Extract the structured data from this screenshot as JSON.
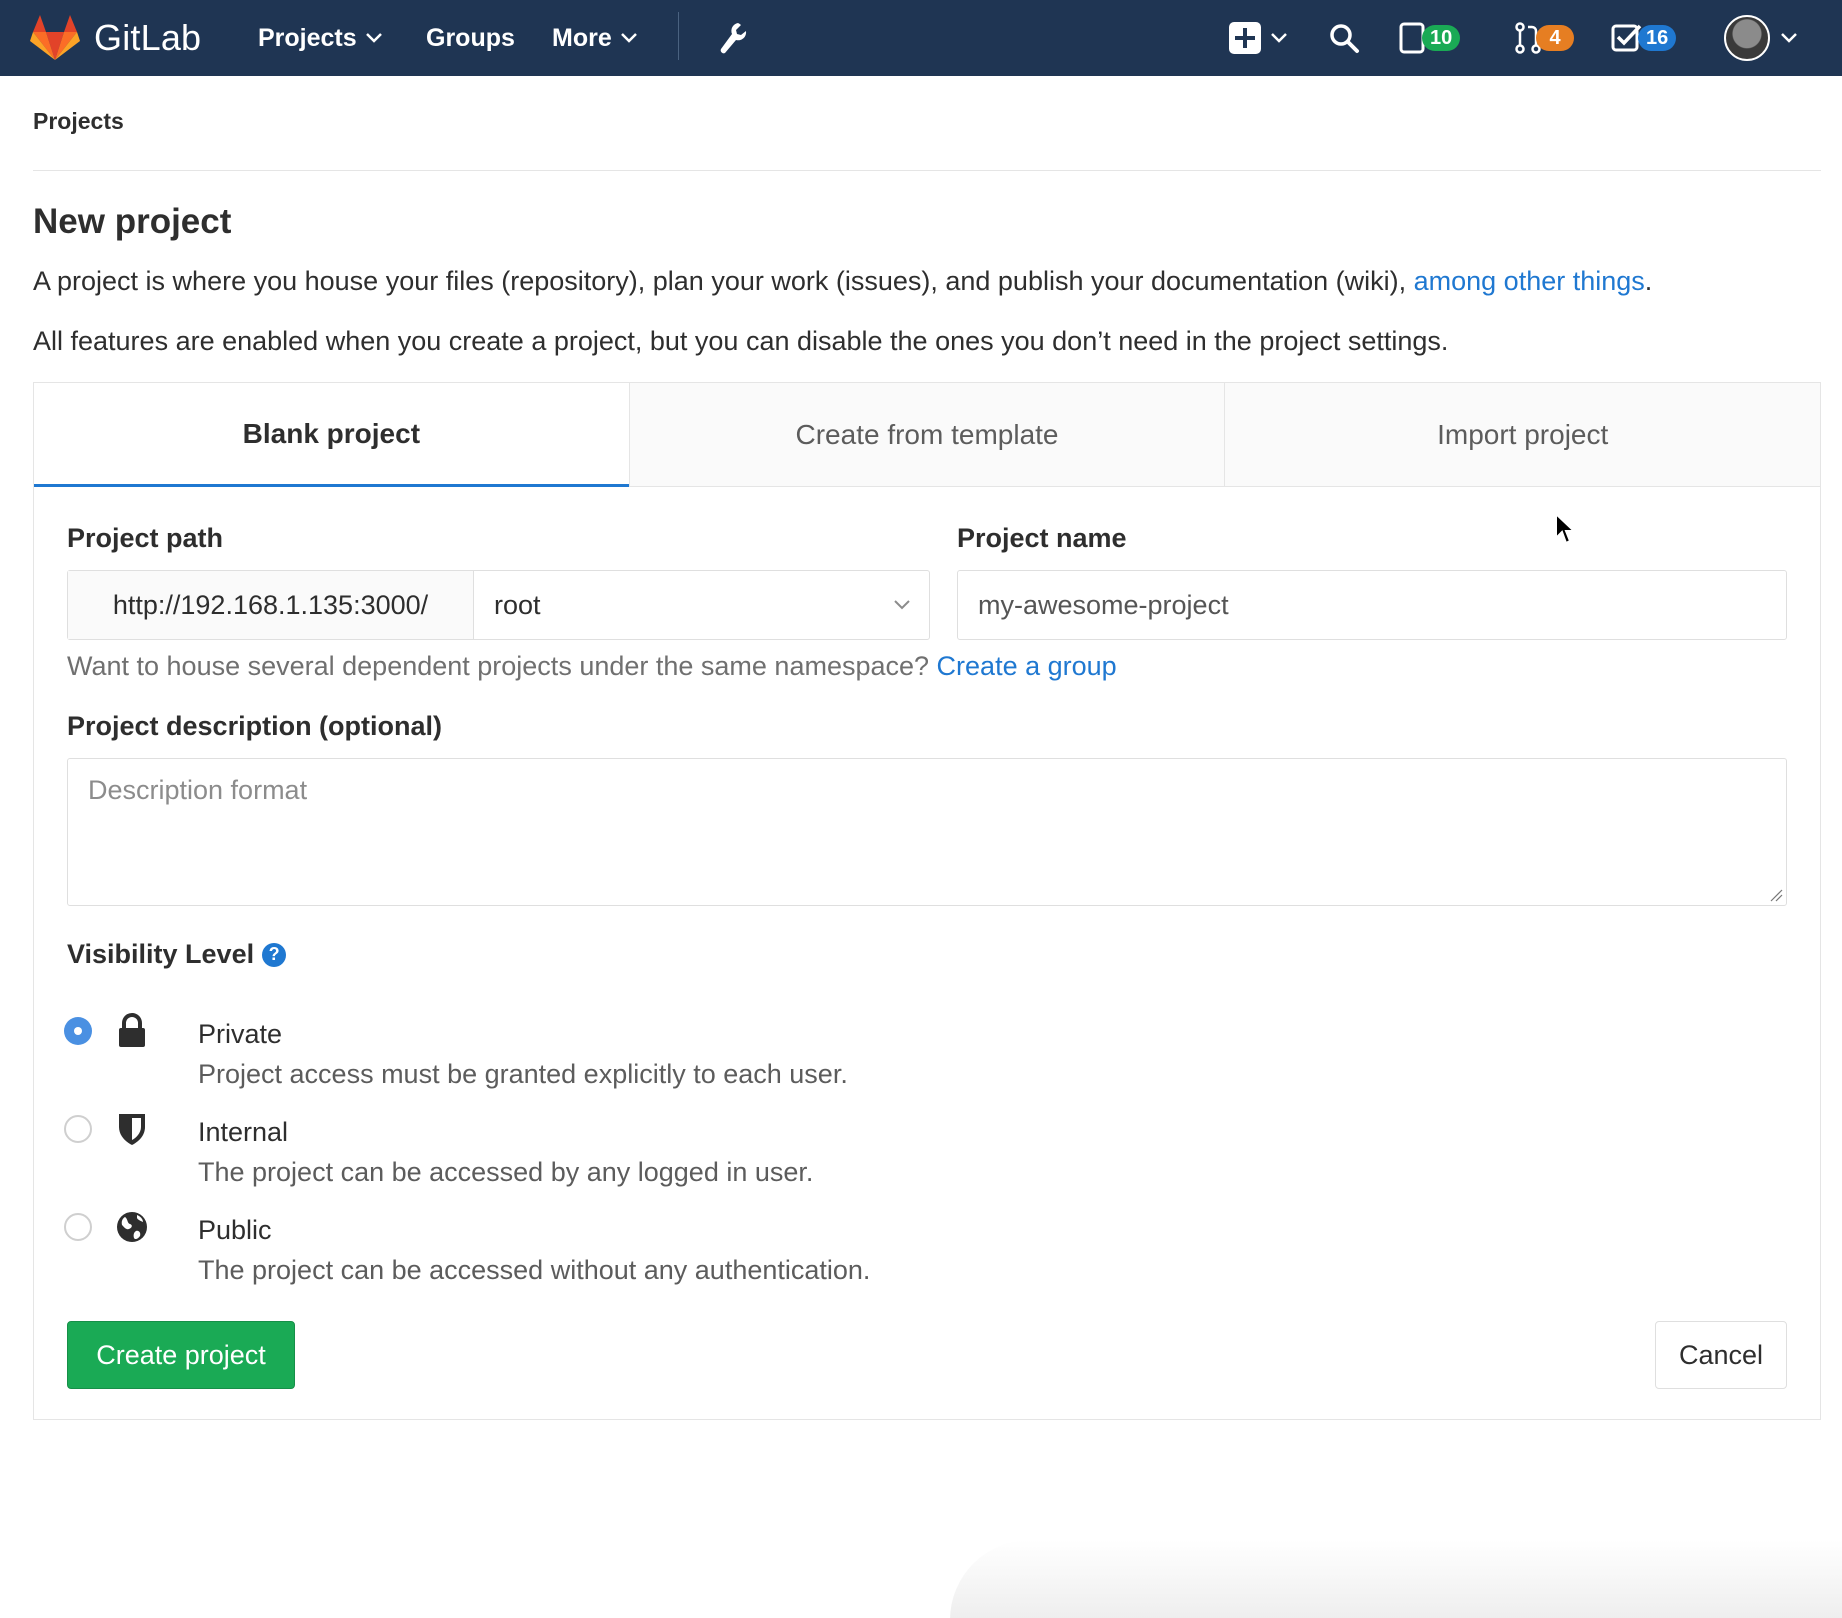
{
  "app": {
    "name": "GitLab"
  },
  "nav": {
    "projects": "Projects",
    "groups": "Groups",
    "more": "More",
    "issues_count": "10",
    "merge_requests_count": "4",
    "todos_count": "16",
    "icons": [
      "gitlab-logo",
      "chevron-down-icon",
      "wrench-icon",
      "plus-square-icon",
      "search-icon",
      "issues-icon",
      "merge-request-icon",
      "todo-check-icon",
      "avatar"
    ]
  },
  "breadcrumb": "Projects",
  "page": {
    "title": "New project",
    "intro_prefix": "A project is where you house your files (repository), plan your work (issues), and publish your documentation (wiki), ",
    "intro_link": "among other things",
    "intro_suffix": ".",
    "intro2": "All features are enabled when you create a project, but you can disable the ones you don’t need in the project settings."
  },
  "tabs": [
    "Blank project",
    "Create from template",
    "Import project"
  ],
  "form": {
    "path_label": "Project path",
    "path_prefix": "http://192.168.1.135:3000/",
    "namespace": "root",
    "name_label": "Project name",
    "name_value": "my-awesome-project",
    "namespace_help": "Want to house several dependent projects under the same namespace? ",
    "namespace_help_link": "Create a group",
    "description_label": "Project description (optional)",
    "description_placeholder": "Description format",
    "visibility_label": "Visibility Level",
    "visibility_help": "?",
    "visibility_options": [
      {
        "title": "Private",
        "desc": "Project access must be granted explicitly to each user.",
        "icon": "lock-icon",
        "checked": true
      },
      {
        "title": "Internal",
        "desc": "The project can be accessed by any logged in user.",
        "icon": "shield-icon",
        "checked": false
      },
      {
        "title": "Public",
        "desc": "The project can be accessed without any authentication.",
        "icon": "globe-icon",
        "checked": false
      }
    ],
    "create_button": "Create project",
    "cancel_button": "Cancel"
  },
  "colors": {
    "navbar": "#1f3553",
    "link": "#1f78d1",
    "success": "#1aaa55",
    "warning": "#e67e22"
  }
}
